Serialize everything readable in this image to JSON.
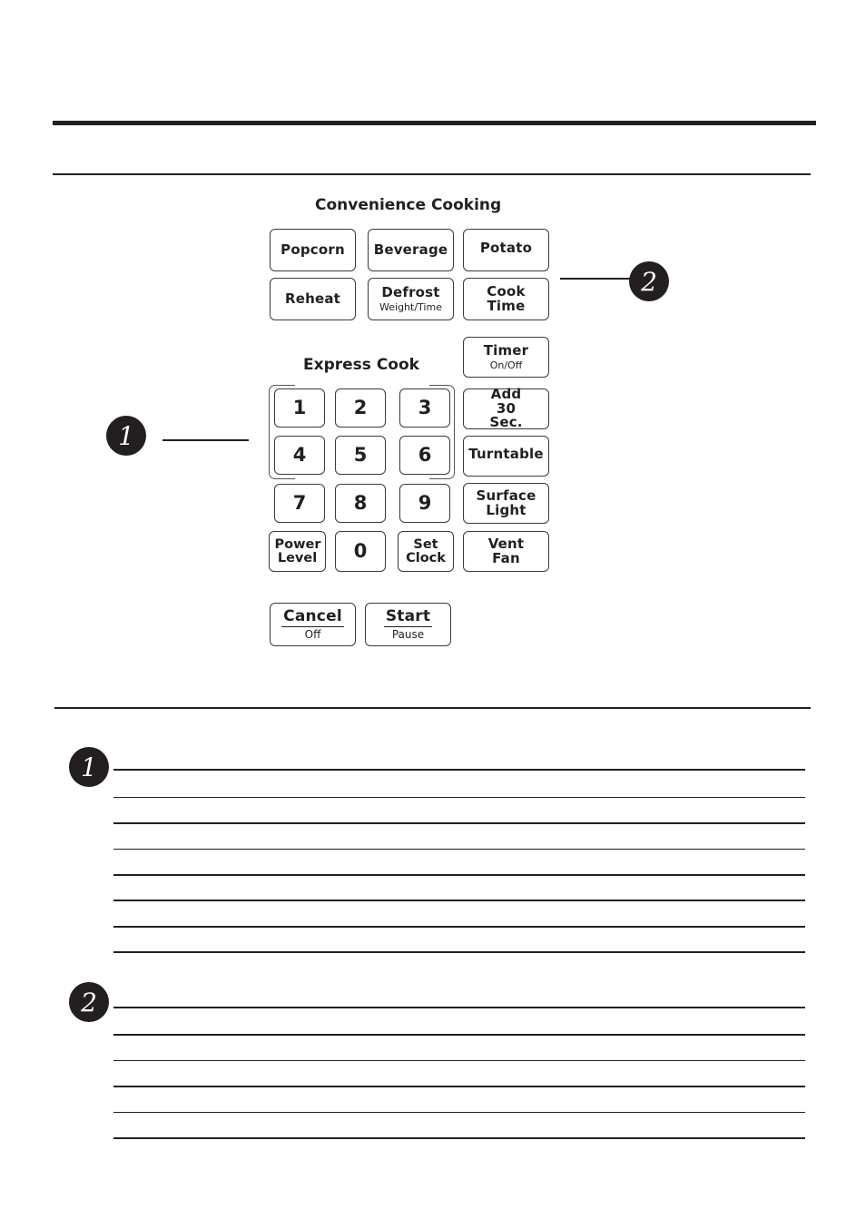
{
  "diagram": {
    "convenience_heading": "Convenience Cooking",
    "express_heading": "Express Cook",
    "convenience_keys": [
      {
        "label": "Popcorn",
        "sub": ""
      },
      {
        "label": "Beverage",
        "sub": ""
      },
      {
        "label": "Potato",
        "sub": ""
      },
      {
        "label": "Reheat",
        "sub": ""
      },
      {
        "label": "Defrost",
        "sub": "Weight/Time"
      },
      {
        "label": "Cook Time",
        "sub": ""
      }
    ],
    "side_keys": [
      {
        "label": "Timer",
        "sub": "On/Off"
      },
      {
        "label": "Add 30 Sec.",
        "sub": ""
      },
      {
        "label": "Turntable",
        "sub": ""
      },
      {
        "label": "Surface Light",
        "sub": ""
      },
      {
        "label": "Vent Fan",
        "sub": ""
      }
    ],
    "number_keys": [
      "1",
      "2",
      "3",
      "4",
      "5",
      "6",
      "7",
      "8",
      "9",
      "0"
    ],
    "power_level": "Power Level",
    "set_clock": "Set Clock",
    "cancel": {
      "label": "Cancel",
      "sub": "Off"
    },
    "start": {
      "label": "Start",
      "sub": "Pause"
    },
    "callouts": [
      "1",
      "2"
    ]
  },
  "sections": [
    {
      "badge": "1",
      "lines": 8
    },
    {
      "badge": "2",
      "lines": 6
    }
  ]
}
